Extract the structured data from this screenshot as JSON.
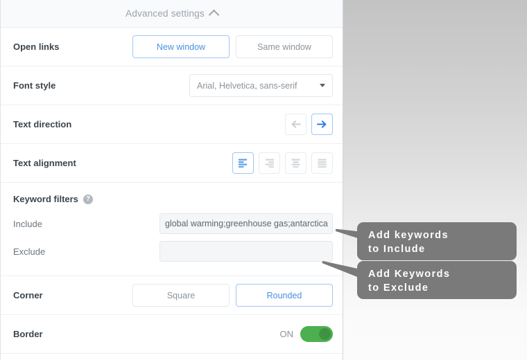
{
  "header": {
    "title": "Advanced settings",
    "collapse_icon": "chevron-up-icon"
  },
  "rows": {
    "open_links": {
      "label": "Open links",
      "options": [
        "New window",
        "Same window"
      ],
      "selected": "New window"
    },
    "font_style": {
      "label": "Font style",
      "value": "Arial, Helvetica, sans-serif",
      "caret_icon": "chevron-down-icon"
    },
    "text_direction": {
      "label": "Text direction",
      "options": [
        "arrow-left-icon",
        "arrow-right-icon"
      ],
      "selected": "arrow-right-icon"
    },
    "text_alignment": {
      "label": "Text alignment",
      "options": [
        "align-left-icon",
        "align-right-icon",
        "align-center-icon",
        "align-justify-icon"
      ],
      "selected": "align-left-icon"
    },
    "corner": {
      "label": "Corner",
      "options": [
        "Square",
        "Rounded"
      ],
      "selected": "Rounded"
    },
    "border": {
      "label": "Border",
      "state": "ON",
      "enabled": true
    }
  },
  "keyword_filters": {
    "title": "Keyword filters",
    "help_icon": "help-circle-icon",
    "help_glyph": "?",
    "include": {
      "label": "Include",
      "value": "global warming;greenhouse gas;antarctica",
      "placeholder": ""
    },
    "exclude": {
      "label": "Exclude",
      "value": "",
      "placeholder": ""
    }
  },
  "callouts": [
    {
      "id": "include",
      "line1": "Add keywords",
      "line2": "to Include"
    },
    {
      "id": "exclude",
      "line1": "Add Keywords",
      "line2": "to Exclude"
    }
  ],
  "colors": {
    "accent_blue": "#4a90e2",
    "accent_blue_border": "#9ec7f5",
    "toggle_green": "#4caf50",
    "toggle_knob": "#3f9243",
    "callout_gray": "#7a7a7a",
    "label_dark": "#3b444c",
    "muted_gray": "#8b949b"
  }
}
